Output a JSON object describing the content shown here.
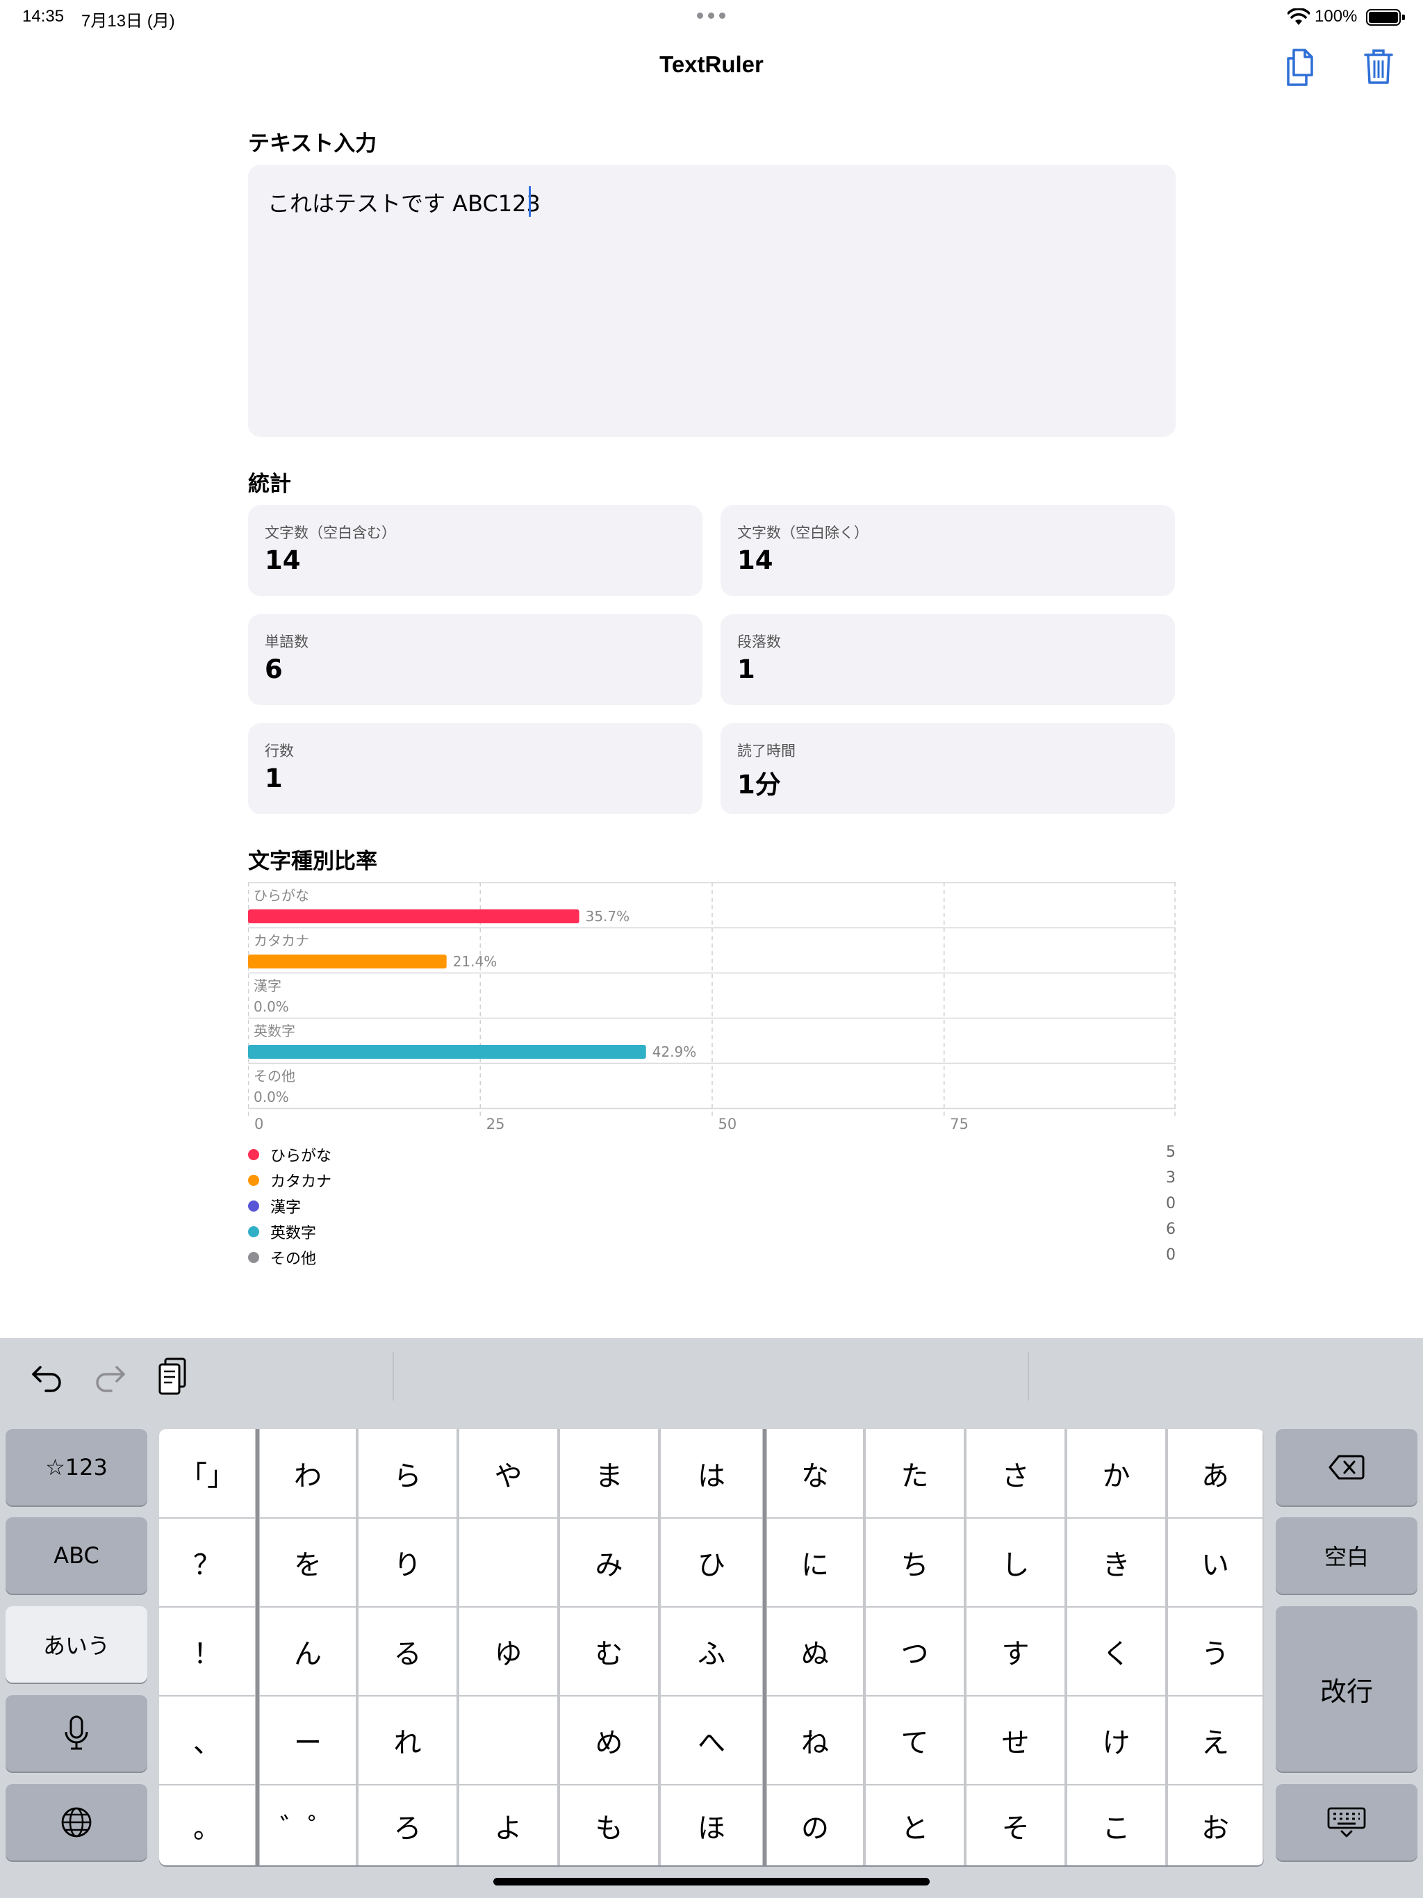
{
  "status": {
    "time": "14:35",
    "date": "7月13日 (月)",
    "battery": "100%"
  },
  "nav": {
    "title": "TextRuler",
    "copy_icon": "copy-icon",
    "trash_icon": "trash-icon"
  },
  "input": {
    "section": "テキスト入力",
    "value": "これはテストです ABC123"
  },
  "stats": {
    "section": "統計",
    "cards": [
      {
        "label": "文字数（空白含む）",
        "value": "14"
      },
      {
        "label": "文字数（空白除く）",
        "value": "14"
      },
      {
        "label": "単語数",
        "value": "6"
      },
      {
        "label": "段落数",
        "value": "1"
      },
      {
        "label": "行数",
        "value": "1"
      },
      {
        "label": "読了時間",
        "value": "1分"
      }
    ]
  },
  "chart_section": "文字種別比率",
  "chart_data": {
    "type": "bar",
    "orientation": "horizontal",
    "categories": [
      "ひらがな",
      "カタカナ",
      "漢字",
      "英数字",
      "その他"
    ],
    "values": [
      35.7,
      21.4,
      0.0,
      42.9,
      0.0
    ],
    "value_labels": [
      "35.7%",
      "21.4%",
      "0.0%",
      "42.9%",
      "0.0%"
    ],
    "xlim": [
      0,
      100
    ],
    "xticks": [
      "0",
      "25",
      "50",
      "75"
    ],
    "grid": true,
    "colors": [
      "#ff2d55",
      "#ff9500",
      "#5856d6",
      "#30b0c7",
      "#8e8e93"
    ]
  },
  "legend": [
    {
      "name": "ひらがな",
      "count": "5",
      "color": "#ff2d55"
    },
    {
      "name": "カタカナ",
      "count": "3",
      "color": "#ff9500"
    },
    {
      "name": "漢字",
      "count": "0",
      "color": "#5856d6"
    },
    {
      "name": "英数字",
      "count": "6",
      "color": "#30b0c7"
    },
    {
      "name": "その他",
      "count": "0",
      "color": "#8e8e93"
    }
  ],
  "keyboard": {
    "left_keys": [
      "☆123",
      "ABC",
      "あいう",
      "mic-icon",
      "globe-icon"
    ],
    "right_keys": [
      "delete-icon",
      "空白",
      "改行",
      "keyboard-dismiss-icon"
    ],
    "rows": [
      [
        "「」",
        "わ",
        "ら",
        "や",
        "ま",
        "は",
        "な",
        "た",
        "さ",
        "か",
        "あ"
      ],
      [
        "？",
        "を",
        "り",
        "",
        "み",
        "ひ",
        "に",
        "ち",
        "し",
        "き",
        "い"
      ],
      [
        "！",
        "ん",
        "る",
        "ゆ",
        "む",
        "ふ",
        "ぬ",
        "つ",
        "す",
        "く",
        "う"
      ],
      [
        "、",
        "ー",
        "れ",
        "",
        "め",
        "へ",
        "ね",
        "て",
        "せ",
        "け",
        "え"
      ],
      [
        "。",
        "゛゜",
        "ろ",
        "よ",
        "も",
        "ほ",
        "の",
        "と",
        "そ",
        "こ",
        "お"
      ]
    ]
  }
}
